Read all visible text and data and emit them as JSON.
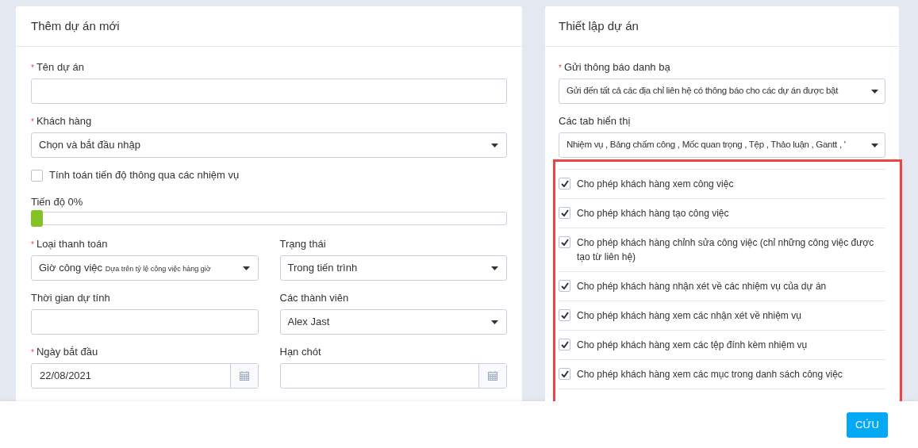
{
  "left_panel": {
    "title": "Thêm dự án mới",
    "project_name": {
      "label": "Tên dự án",
      "required_mark": "*"
    },
    "customer": {
      "label": "Khách hàng",
      "required_mark": "*",
      "value": "Chọn và bắt đầu nhập"
    },
    "calc_progress": {
      "label": "Tính toán tiến độ thông qua các nhiệm vụ",
      "checked": false
    },
    "progress": {
      "label": "Tiến độ 0%",
      "level": 0
    },
    "billing_type": {
      "label": "Loại thanh toán",
      "required_mark": "*",
      "value": "Giờ công việc",
      "note": "Dựa trên tỷ lệ công việc hàng giờ"
    },
    "status": {
      "label": "Trạng thái",
      "value": "Trong tiến trình"
    },
    "estimated_hours": {
      "label": "Thời gian dự tính"
    },
    "members": {
      "label": "Các thành viên",
      "value": "Alex Jast"
    },
    "start_date": {
      "label": "Ngày bắt đầu",
      "required_mark": "*",
      "value": "22/08/2021"
    },
    "deadline": {
      "label": "Hạn chót"
    }
  },
  "right_panel": {
    "title": "Thiết lập dự án",
    "contact_notifications": {
      "label": "Gửi thông báo danh bạ",
      "required_mark": "*",
      "value": "Gửi đến tất cả các địa chỉ liên hệ có thông báo cho các dự án được bật"
    },
    "visible_tabs": {
      "label": "Các tab hiển thị",
      "value": "Nhiệm vụ , Bảng chấm công , Mốc quan trọng , Tệp , Thảo luận , Gantt , '"
    },
    "permissions": [
      {
        "label": "Cho phép khách hàng xem công việc",
        "checked": true
      },
      {
        "label": "Cho phép khách hàng tạo công việc",
        "checked": true
      },
      {
        "label": "Cho phép khách hàng chỉnh sửa công việc (chỉ những công việc được tạo từ liên hệ)",
        "checked": true
      },
      {
        "label": "Cho phép khách hàng nhận xét về các nhiệm vụ của dự án",
        "checked": true
      },
      {
        "label": "Cho phép khách hàng xem các nhận xét về nhiệm vụ",
        "checked": true
      },
      {
        "label": "Cho phép khách hàng xem các tệp đính kèm nhiệm vụ",
        "checked": true
      },
      {
        "label": "Cho phép khách hàng xem các mục trong danh sách công việc",
        "checked": true
      }
    ]
  },
  "footer": {
    "save_button": "CỨU"
  }
}
